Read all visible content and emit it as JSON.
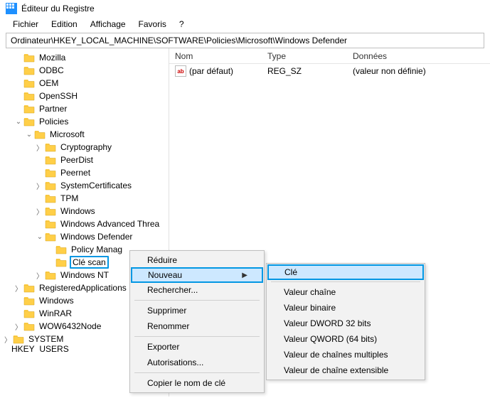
{
  "window": {
    "title": "Éditeur du Registre"
  },
  "menu": {
    "file": "Fichier",
    "edit": "Edition",
    "view": "Affichage",
    "fav": "Favoris",
    "help": "?"
  },
  "address": "Ordinateur\\HKEY_LOCAL_MACHINE\\SOFTWARE\\Policies\\Microsoft\\Windows Defender",
  "list": {
    "cols": {
      "name": "Nom",
      "type": "Type",
      "data": "Données"
    },
    "rows": [
      {
        "icon": "ab",
        "name": "(par défaut)",
        "type": "REG_SZ",
        "data": "(valeur non définie)"
      }
    ]
  },
  "tree": {
    "top": [
      {
        "chev": "",
        "label": "Mozilla"
      },
      {
        "chev": "",
        "label": "ODBC"
      },
      {
        "chev": "",
        "label": "OEM"
      },
      {
        "chev": "",
        "label": "OpenSSH"
      },
      {
        "chev": "",
        "label": "Partner"
      },
      {
        "chev": "v",
        "label": "Policies"
      }
    ],
    "policies": [
      {
        "chev": "v",
        "label": "Microsoft"
      }
    ],
    "microsoft": [
      {
        "chev": ">",
        "label": "Cryptography"
      },
      {
        "chev": "",
        "label": "PeerDist"
      },
      {
        "chev": "",
        "label": "Peernet"
      },
      {
        "chev": ">",
        "label": "SystemCertificates"
      },
      {
        "chev": "",
        "label": "TPM"
      },
      {
        "chev": ">",
        "label": "Windows"
      },
      {
        "chev": "",
        "label": "Windows Advanced Threa"
      },
      {
        "chev": "v",
        "label": "Windows Defender"
      }
    ],
    "defender": [
      {
        "chev": "",
        "label": "Policy Manag"
      },
      {
        "chev": "",
        "label": "Clé scan",
        "selected": true
      }
    ],
    "after_defender": [
      {
        "chev": ">",
        "label": "Windows NT"
      }
    ],
    "after_policies": [
      {
        "chev": ">",
        "label": "RegisteredApplications"
      },
      {
        "chev": "",
        "label": "Windows"
      },
      {
        "chev": "",
        "label": "WinRAR"
      },
      {
        "chev": ">",
        "label": "WOW6432Node"
      }
    ],
    "hklm_siblings": [
      {
        "chev": ">",
        "label": "SYSTEM"
      }
    ],
    "cutoff": "HKEY_USERS"
  },
  "ctx1": {
    "reduce": "Réduire",
    "new": "Nouveau",
    "find": "Rechercher...",
    "delete": "Supprimer",
    "rename": "Renommer",
    "export": "Exporter",
    "perms": "Autorisations...",
    "copykey": "Copier le nom de clé"
  },
  "ctx2": {
    "key": "Clé",
    "string": "Valeur chaîne",
    "binary": "Valeur binaire",
    "dword": "Valeur DWORD 32 bits",
    "qword": "Valeur QWORD (64 bits)",
    "multi": "Valeur de chaînes multiples",
    "expand": "Valeur de chaîne extensible"
  }
}
